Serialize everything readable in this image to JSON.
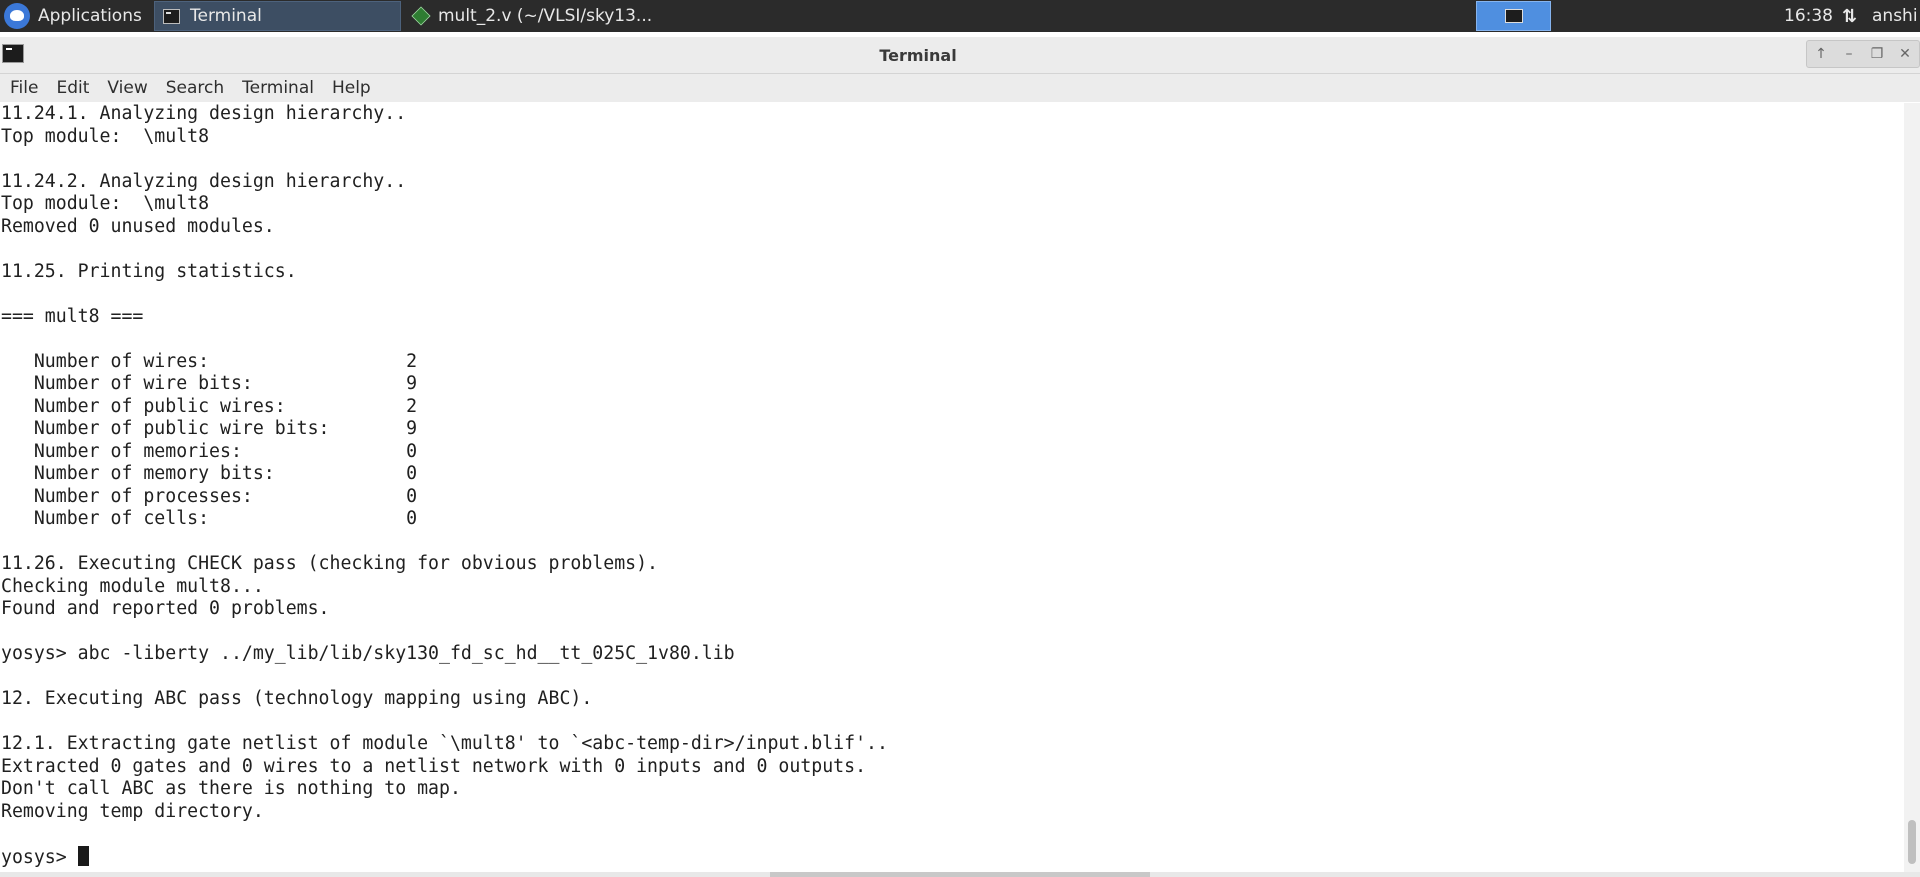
{
  "taskbar": {
    "applications_label": "Applications",
    "tasks": [
      {
        "label": "Terminal",
        "active": true
      },
      {
        "label": "mult_2.v (~/VLSI/sky13...",
        "active": false
      }
    ],
    "clock": "16:38",
    "network_glyph": "⇅",
    "user": "anshi"
  },
  "window": {
    "title": "Terminal",
    "controls": [
      "↑",
      "–",
      "❐",
      "✕"
    ]
  },
  "menu": [
    "File",
    "Edit",
    "View",
    "Search",
    "Terminal",
    "Help"
  ],
  "terminal": {
    "lines": [
      "11.24.1. Analyzing design hierarchy..",
      "Top module:  \\mult8",
      "",
      "11.24.2. Analyzing design hierarchy..",
      "Top module:  \\mult8",
      "Removed 0 unused modules.",
      "",
      "11.25. Printing statistics.",
      "",
      "=== mult8 ===",
      "",
      "   Number of wires:                  2",
      "   Number of wire bits:              9",
      "   Number of public wires:           2",
      "   Number of public wire bits:       9",
      "   Number of memories:               0",
      "   Number of memory bits:            0",
      "   Number of processes:              0",
      "   Number of cells:                  0",
      "",
      "11.26. Executing CHECK pass (checking for obvious problems).",
      "Checking module mult8...",
      "Found and reported 0 problems.",
      "",
      "yosys> abc -liberty ../my_lib/lib/sky130_fd_sc_hd__tt_025C_1v80.lib",
      "",
      "12. Executing ABC pass (technology mapping using ABC).",
      "",
      "12.1. Extracting gate netlist of module `\\mult8' to `<abc-temp-dir>/input.blif'..",
      "Extracted 0 gates and 0 wires to a netlist network with 0 inputs and 0 outputs.",
      "Don't call ABC as there is nothing to map.",
      "Removing temp directory.",
      ""
    ],
    "prompt": "yosys> "
  }
}
